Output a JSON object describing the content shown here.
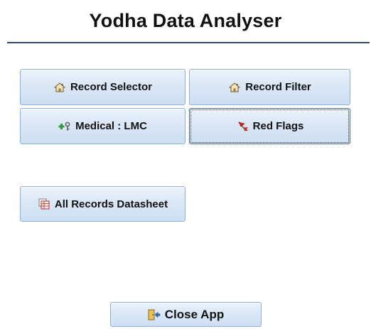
{
  "app": {
    "title": "Yodha Data Analyser"
  },
  "buttons": {
    "record_selector": {
      "label": "Record Selector",
      "icon": "home-icon"
    },
    "record_filter": {
      "label": "Record Filter",
      "icon": "home-icon"
    },
    "medical_lmc": {
      "label": "Medical : LMC",
      "icon": "medical-key-icon"
    },
    "red_flags": {
      "label": "Red Flags",
      "icon": "red-flag-icon"
    },
    "all_records_datasheet": {
      "label": "All Records Datasheet",
      "icon": "datasheet-icon"
    },
    "close_app": {
      "label": "Close App",
      "icon": "exit-door-icon"
    }
  },
  "colors": {
    "title_rule": "#2c4a6e",
    "button_border": "#8fb0d6",
    "button_fill_top": "#ecf3fc",
    "button_fill_bottom": "#cddff2"
  }
}
